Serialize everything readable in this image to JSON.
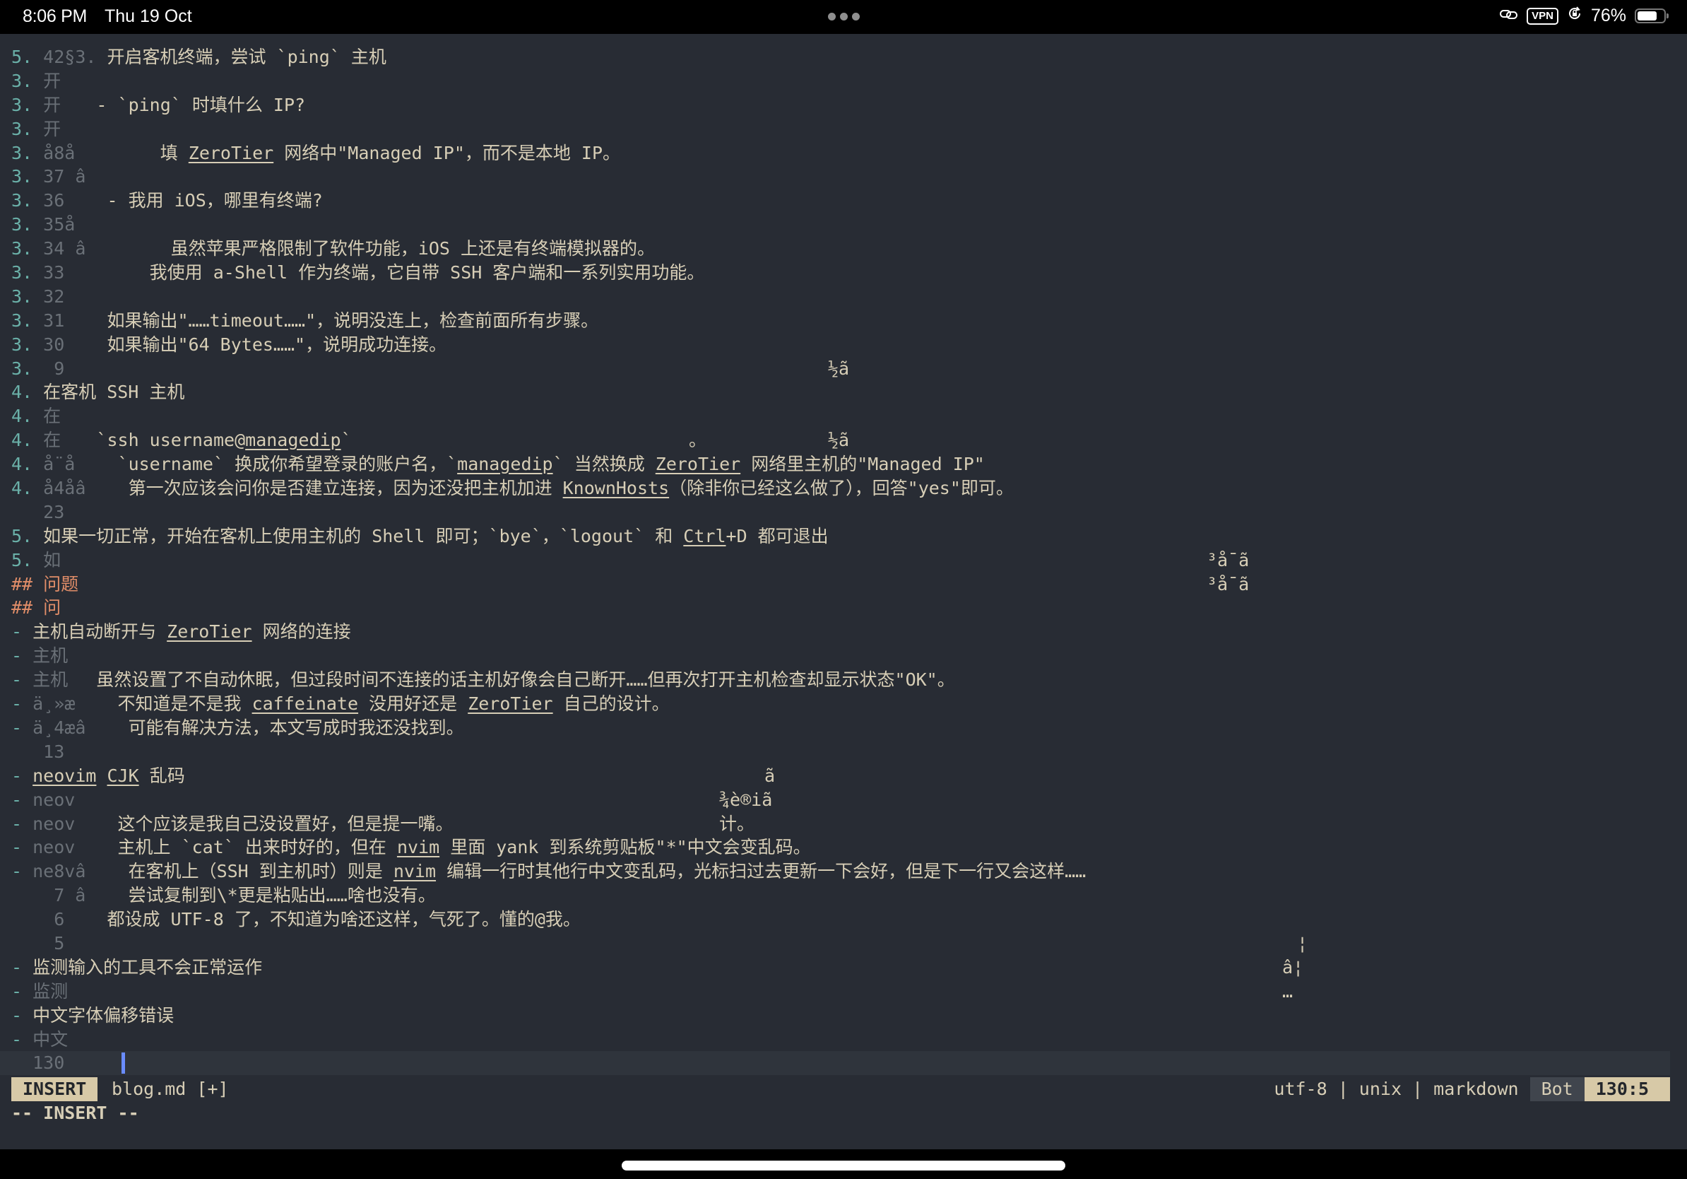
{
  "status_bar": {
    "time": "8:06 PM",
    "date": "Thu 19 Oct",
    "vpn_label": "VPN",
    "battery_percent_label": "76%",
    "battery_level": 0.76
  },
  "editor": {
    "rows": [
      {
        "ln": "5. 42§3.",
        "text": " 开启客机终端，尝试 `ping` 主机"
      },
      {
        "ln": "3. 开",
        "text": ""
      },
      {
        "ln": "3. 开",
        "text": "    - `ping` 时填什么 IP?"
      },
      {
        "ln": "3. 开",
        "text": ""
      },
      {
        "ln": "3. å8å",
        "text": "        填 ZeroTier 网络中\"Managed IP\"，而不是本地 IP。"
      },
      {
        "ln": "3. 37 â",
        "text": ""
      },
      {
        "ln": "3. 36",
        "text": "    - 我用 iOS，哪里有终端?"
      },
      {
        "ln": "3. 35å",
        "text": ""
      },
      {
        "ln": "3. 34 â",
        "text": "        虽然苹果严格限制了软件功能，iOS 上还是有终端模拟器的。"
      },
      {
        "ln": "3. 33",
        "text": "        我使用 a-Shell 作为终端，它自带 SSH 客户端和一系列实用功能。"
      },
      {
        "ln": "3. 32",
        "text": ""
      },
      {
        "ln": "3. 31",
        "text": "    如果输出\"……timeout……\"，说明没连上，检查前面所有步骤。"
      },
      {
        "ln": "3. 30",
        "text": "    如果输出\"64 Bytes……\"，说明成功连接。"
      },
      {
        "ln": "3.  9",
        "text": ""
      },
      {
        "ln": "4.",
        "text": " 在客机 SSH 主机"
      },
      {
        "ln": "4. 在",
        "text": ""
      },
      {
        "ln": "4. 在",
        "text": "    `ssh username@managedip`"
      },
      {
        "ln": "4. å¨å",
        "text": "    `username` 换成你希望登录的账户名，`managedip` 当然换成 ZeroTier 网络里主机的\"Managed IP\""
      },
      {
        "ln": "4. å4åâ",
        "text": "    第一次应该会问你是否建立连接，因为还没把主机加进 KnownHosts（除非你已经这么做了），回答\"yes\"即可。"
      },
      {
        "ln": "   23",
        "text": ""
      },
      {
        "ln": "5.",
        "text": " 如果一切正常，开始在客机上使用主机的 Shell 即可；`bye`，`logout` 和 Ctrl+D 都可退出"
      },
      {
        "ln": "5. 如",
        "text": ""
      },
      {
        "ln": "##",
        "text": " 问题",
        "heading": true
      },
      {
        "ln": "## 问",
        "text": "",
        "heading": true
      },
      {
        "ln": "-",
        "text": " 主机自动断开与 ZeroTier 网络的连接"
      },
      {
        "ln": "- 主机",
        "text": ""
      },
      {
        "ln": "- 主机",
        "text": "    虽然设置了不自动休眠，但过段时间不连接的话主机好像会自己断开……但再次打开主机检查却显示状态\"OK\"。"
      },
      {
        "ln": "- ä¸»æ",
        "text": "    不知道是不是我 caffeinate 没用好还是 ZeroTier 自己的设计。"
      },
      {
        "ln": "- ä¸4æâ",
        "text": "    可能有解决方法，本文写成时我还没找到。"
      },
      {
        "ln": "   13",
        "text": ""
      },
      {
        "ln": "-",
        "text": " neovim CJK 乱码"
      },
      {
        "ln": "- neov",
        "text": ""
      },
      {
        "ln": "- neov",
        "text": "    这个应该是我自己没设置好，但是提一嘴。"
      },
      {
        "ln": "- neov",
        "text": "    主机上 `cat` 出来时好的，但在 nvim 里面 yank 到系统剪贴板\"*\"中文会变乱码。"
      },
      {
        "ln": "- ne8vâ",
        "text": "    在客机上（SSH 到主机时）则是 nvim 编辑一行时其他行中文变乱码，光标扫过去更新一下会好，但是下一行又会这样……"
      },
      {
        "ln": "    7 â",
        "text": "    尝试复制到\\*更是粘贴出……啥也没有。"
      },
      {
        "ln": "    6",
        "text": "    都设成 UTF-8 了，不知道为啥还这样，气死了。懂的@我。"
      },
      {
        "ln": "    5",
        "text": ""
      },
      {
        "ln": "-",
        "text": " 监测输入的工具不会正常运作"
      },
      {
        "ln": "- 监测",
        "text": ""
      },
      {
        "ln": "-",
        "text": " 中文字体偏移错误"
      },
      {
        "ln": "- 中文",
        "text": ""
      },
      {
        "ln": "  130",
        "text": "",
        "cursorline": true
      }
    ],
    "glitch_fragments": [
      {
        "row": 13,
        "text": "½ã"
      },
      {
        "row": 16,
        "text": "。"
      },
      {
        "row": 16,
        "text": "½ã"
      },
      {
        "row": 21,
        "text": "³å¯ã"
      },
      {
        "row": 22,
        "text": "³å¯ã"
      },
      {
        "row": 30,
        "text": "ã"
      },
      {
        "row": 31,
        "text": "¾è®iã"
      },
      {
        "row": 32,
        "text": "计。"
      },
      {
        "row": 37,
        "text": "¦"
      },
      {
        "row": 38,
        "text": "â¦"
      },
      {
        "row": 39,
        "text": "…"
      }
    ]
  },
  "statusline": {
    "mode": "INSERT",
    "filename": "blog.md [+]",
    "fileinfo": "utf-8 | unix | markdown",
    "position_label": "Bot",
    "cursor_position": "130:5"
  },
  "cmdline": "-- INSERT --",
  "colors": {
    "background": "#282c34",
    "foreground": "#d7ceb6",
    "list_marker": "#6ab0a8",
    "heading": "#e08d68",
    "mode_badge": "#d7c9a7",
    "cursor": "#6a8cff"
  }
}
